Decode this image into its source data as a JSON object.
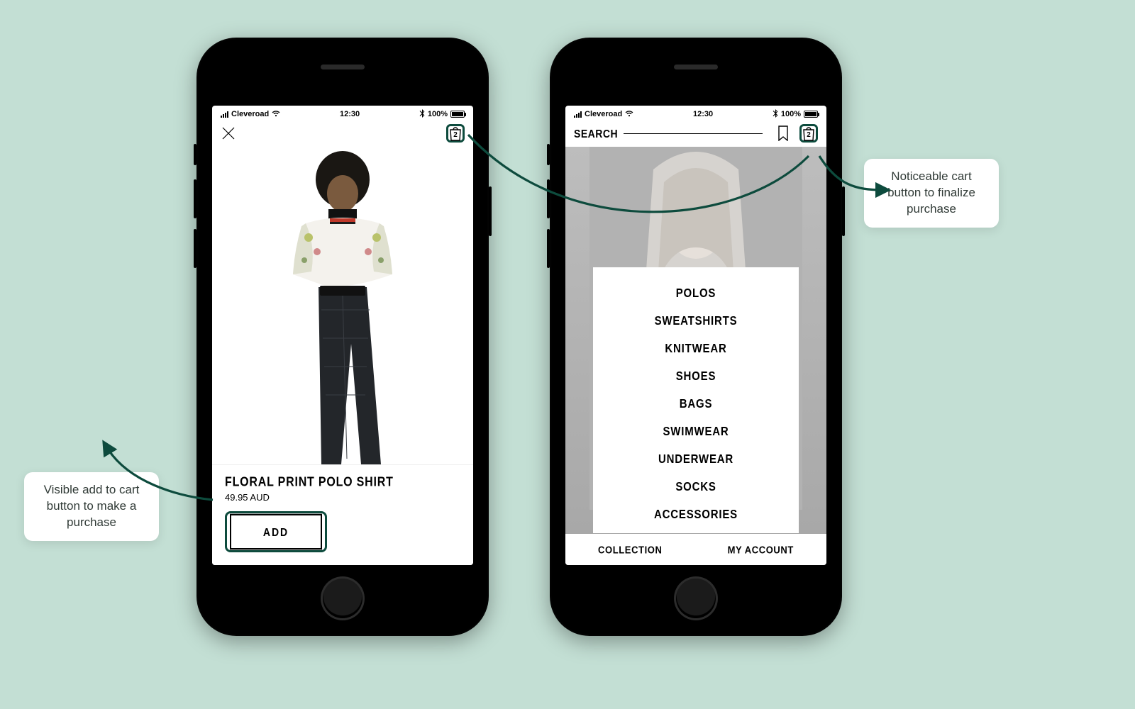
{
  "statusbar": {
    "carrier": "Cleveroad",
    "time": "12:30",
    "battery": "100%"
  },
  "phone1": {
    "cart_count": "2",
    "product": {
      "title": "FLORAL PRINT POLO SHIRT",
      "price": "49.95 AUD",
      "add_label": "ADD"
    }
  },
  "phone2": {
    "search_label": "SEARCH",
    "cart_count": "2",
    "categories": [
      "POLOS",
      "SWEATSHIRTS",
      "KNITWEAR",
      "SHOES",
      "BAGS",
      "SWIMWEAR",
      "UNDERWEAR",
      "SOCKS",
      "ACCESSORIES"
    ],
    "tabs": {
      "collection": "COLLECTION",
      "account": "MY ACCOUNT"
    }
  },
  "callouts": {
    "left": "Visible add to cart button to make a purchase",
    "right": "Noticeable cart button to finalize purchase"
  },
  "colors": {
    "accent": "#0d4b3d",
    "bg": "#c3dfd4"
  }
}
